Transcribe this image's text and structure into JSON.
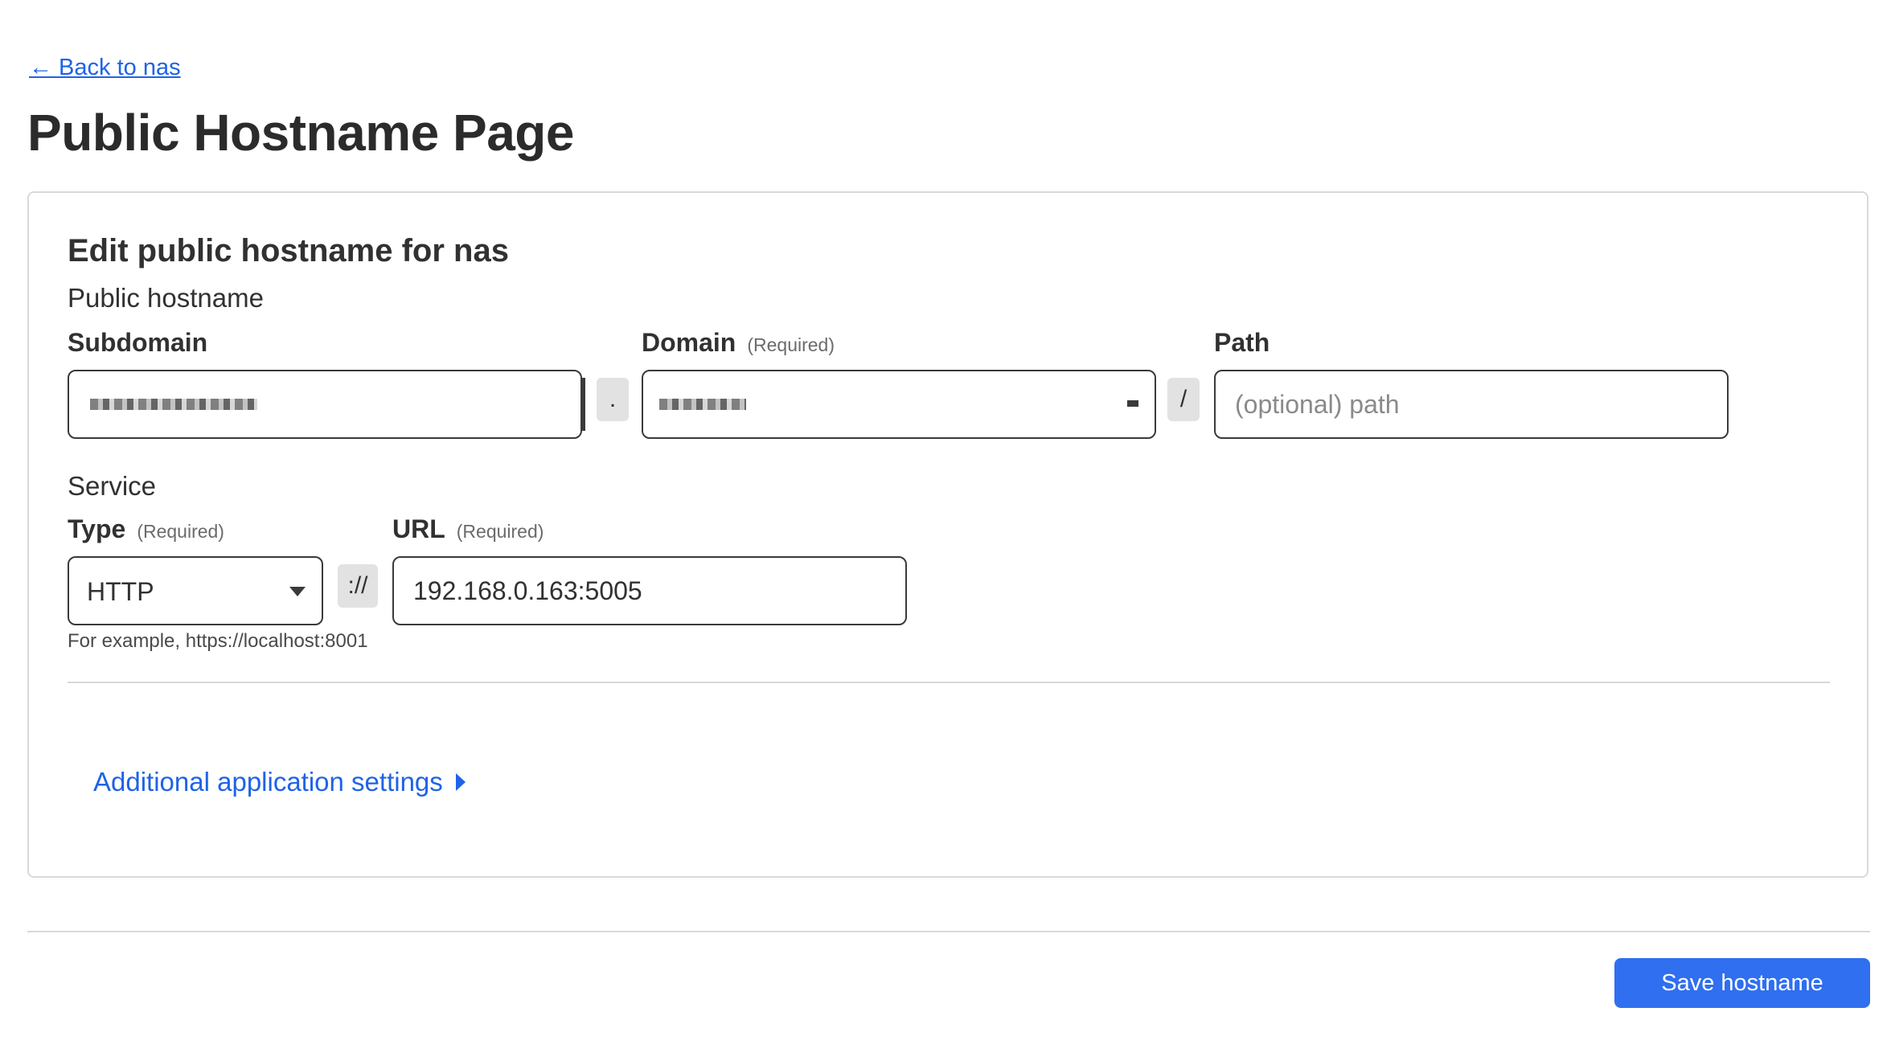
{
  "nav": {
    "back_label": "← Back to nas"
  },
  "page": {
    "title": "Public Hostname Page"
  },
  "card": {
    "title": "Edit public hostname for nas",
    "public_hostname_label": "Public hostname",
    "subdomain": {
      "label": "Subdomain",
      "value": ""
    },
    "dot_separator": ".",
    "domain": {
      "label": "Domain",
      "required": "(Required)",
      "value": ""
    },
    "slash_separator": "/",
    "path": {
      "label": "Path",
      "placeholder": "(optional) path",
      "value": ""
    },
    "service_label": "Service",
    "type": {
      "label": "Type",
      "required": "(Required)",
      "value": "HTTP"
    },
    "scheme_separator": "://",
    "url": {
      "label": "URL",
      "required": "(Required)",
      "value": "192.168.0.163:5005"
    },
    "hint": "For example, https://localhost:8001",
    "additional_settings": "Additional application settings"
  },
  "footer": {
    "save_label": "Save hostname"
  },
  "colors": {
    "accent": "#2f6ff0",
    "link": "#1f63e6",
    "border": "#3a3a3a"
  }
}
